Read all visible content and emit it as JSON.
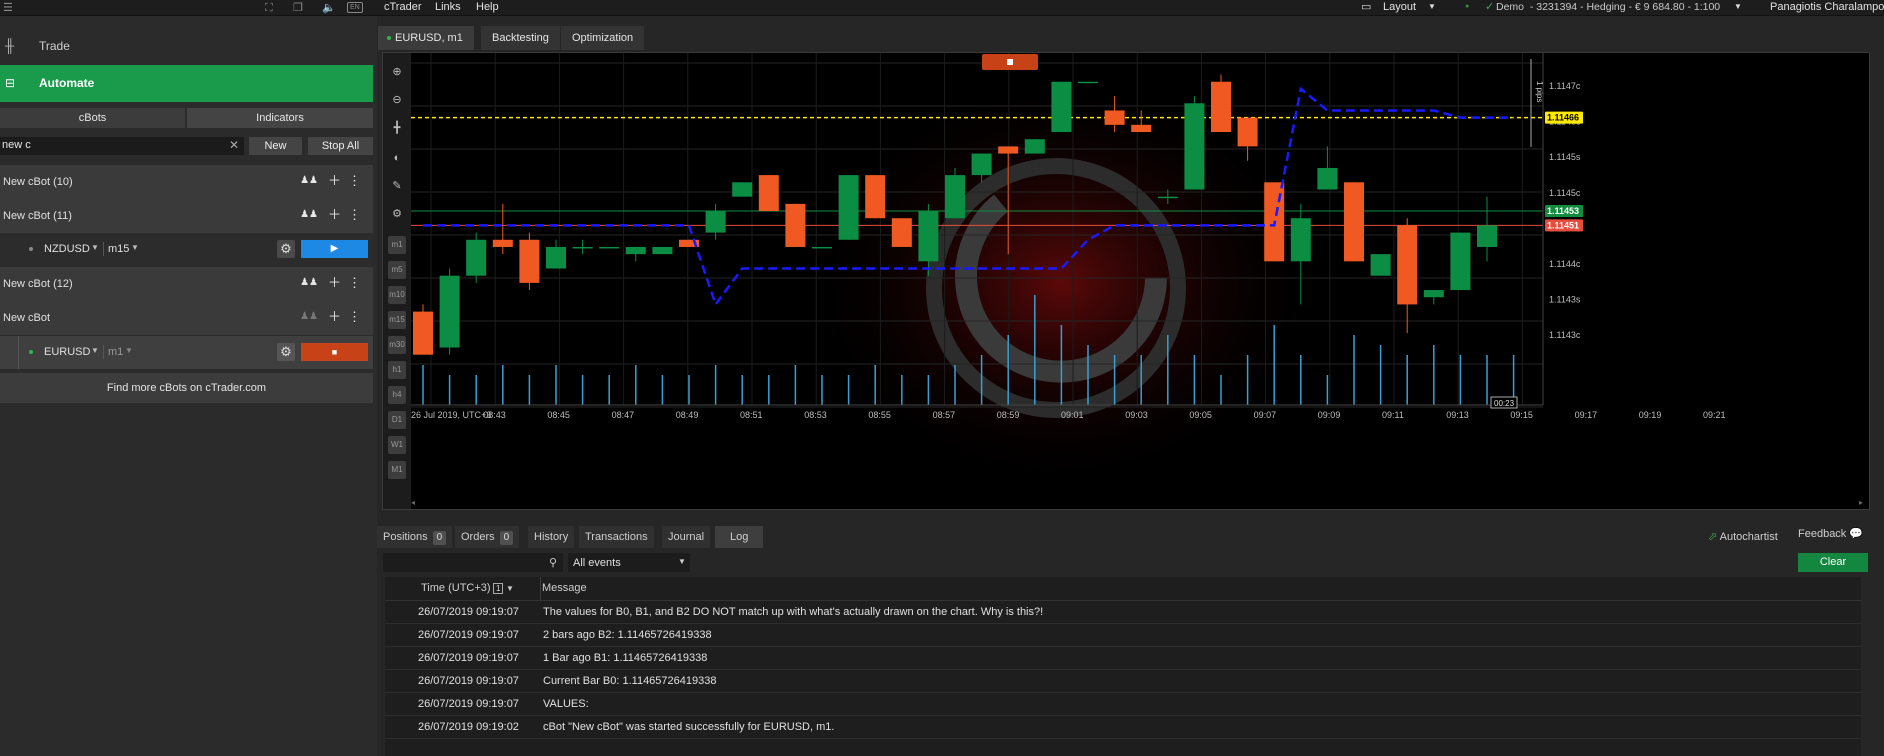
{
  "top_bar": {
    "icons": [
      "hamburger-menu-icon",
      "fullscreen-icon",
      "windows-icon",
      "sound-icon",
      "language-icon"
    ],
    "language": "EN",
    "menu": [
      "cTrader",
      "Links",
      "Help"
    ],
    "layout_label": "Layout",
    "account_info": "Demo  - 3231394 - Hedging - € 9 684.80 - 1:100",
    "user_name": "Panagiotis Charalampous"
  },
  "sidebar": {
    "trade_label": "Trade",
    "automate_label": "Automate",
    "tabs": [
      "cBots",
      "Indicators"
    ],
    "search_value": "new c",
    "new_button": "New",
    "stop_all_button": "Stop All",
    "bots": [
      {
        "name": "New cBot (10)"
      },
      {
        "name": "New cBot (11)",
        "instance": {
          "symbol": "NZDUSD",
          "timeframe": "m15",
          "state": "stopped"
        }
      },
      {
        "name": "New cBot (12)"
      },
      {
        "name": "New cBot",
        "instance": {
          "symbol": "EURUSD",
          "timeframe": "m1",
          "state": "running"
        }
      }
    ],
    "find_more": "Find more cBots on cTrader.com",
    "colors": {
      "automate": "#1a9b4b",
      "play": "#1e88e5",
      "stop": "#d04a1c"
    }
  },
  "chart_tabs": [
    "EURUSD, m1",
    "Backtesting",
    "Optimization"
  ],
  "chart_tools": [
    "zoom-in-icon",
    "zoom-out-icon",
    "crosshair-icon",
    "chart-type-icon",
    "drawing-icon",
    "template-icon"
  ],
  "timeframe_buttons": [
    "m1",
    "m5",
    "m10",
    "m15",
    "m30",
    "h1",
    "h4",
    "D1",
    "W1",
    "M1"
  ],
  "chart_data": {
    "type": "candlestick",
    "symbol": "EURUSD",
    "timeframe": "m1",
    "x_labels": [
      "26 Jul 2019, UTC+3",
      "08:43",
      "08:45",
      "08:47",
      "08:49",
      "08:51",
      "08:53",
      "08:55",
      "08:57",
      "08:59",
      "09:01",
      "09:03",
      "09:05",
      "09:07",
      "09:09",
      "09:11",
      "09:13",
      "09:15",
      "09:17",
      "09:19",
      "09:21"
    ],
    "y_labels": [
      "1.1147c",
      "1.1146c",
      "1.1145s",
      "1.1145c",
      "1.1144s",
      "1.1144c",
      "1.1143s",
      "1.1143c"
    ],
    "ylim": [
      1.11426,
      1.11475
    ],
    "candles": [
      {
        "o": 1.11439,
        "h": 1.1144,
        "l": 1.11435,
        "c": 1.11433
      },
      {
        "o": 1.11434,
        "h": 1.11445,
        "l": 1.11433,
        "c": 1.11444
      },
      {
        "o": 1.11444,
        "h": 1.1145,
        "l": 1.11443,
        "c": 1.11449
      },
      {
        "o": 1.11449,
        "h": 1.11454,
        "l": 1.11447,
        "c": 1.11448
      },
      {
        "o": 1.11449,
        "h": 1.1145,
        "l": 1.11442,
        "c": 1.11443
      },
      {
        "o": 1.11445,
        "h": 1.11449,
        "l": 1.11445,
        "c": 1.11448
      },
      {
        "o": 1.11448,
        "h": 1.11449,
        "l": 1.11447,
        "c": 1.11448
      },
      {
        "o": 1.11448,
        "h": 1.11448,
        "l": 1.11448,
        "c": 1.11448
      },
      {
        "o": 1.11447,
        "h": 1.11448,
        "l": 1.11446,
        "c": 1.11448
      },
      {
        "o": 1.11447,
        "h": 1.11448,
        "l": 1.11447,
        "c": 1.11448
      },
      {
        "o": 1.11449,
        "h": 1.11449,
        "l": 1.11448,
        "c": 1.11448
      },
      {
        "o": 1.1145,
        "h": 1.11454,
        "l": 1.11449,
        "c": 1.11453
      },
      {
        "o": 1.11455,
        "h": 1.11457,
        "l": 1.11455,
        "c": 1.11457
      },
      {
        "o": 1.11458,
        "h": 1.11458,
        "l": 1.11453,
        "c": 1.11453
      },
      {
        "o": 1.11454,
        "h": 1.11454,
        "l": 1.11448,
        "c": 1.11448
      },
      {
        "o": 1.11448,
        "h": 1.11448,
        "l": 1.11448,
        "c": 1.11448
      },
      {
        "o": 1.11449,
        "h": 1.11458,
        "l": 1.11449,
        "c": 1.11458
      },
      {
        "o": 1.11458,
        "h": 1.11458,
        "l": 1.11452,
        "c": 1.11452
      },
      {
        "o": 1.11452,
        "h": 1.11452,
        "l": 1.11448,
        "c": 1.11448
      },
      {
        "o": 1.11446,
        "h": 1.11454,
        "l": 1.11444,
        "c": 1.11453
      },
      {
        "o": 1.11452,
        "h": 1.11459,
        "l": 1.11452,
        "c": 1.11458
      },
      {
        "o": 1.11458,
        "h": 1.11461,
        "l": 1.11457,
        "c": 1.11461
      },
      {
        "o": 1.11462,
        "h": 1.11462,
        "l": 1.11447,
        "c": 1.11461
      },
      {
        "o": 1.11461,
        "h": 1.11463,
        "l": 1.11461,
        "c": 1.11463
      },
      {
        "o": 1.11464,
        "h": 1.11471,
        "l": 1.11464,
        "c": 1.11471
      },
      {
        "o": 1.11471,
        "h": 1.11471,
        "l": 1.11471,
        "c": 1.11471
      },
      {
        "o": 1.11467,
        "h": 1.11469,
        "l": 1.11464,
        "c": 1.11465
      },
      {
        "o": 1.11465,
        "h": 1.11467,
        "l": 1.11464,
        "c": 1.11464
      },
      {
        "o": 1.11455,
        "h": 1.11456,
        "l": 1.11454,
        "c": 1.11455
      },
      {
        "o": 1.11456,
        "h": 1.11469,
        "l": 1.11456,
        "c": 1.11468
      },
      {
        "o": 1.11471,
        "h": 1.11472,
        "l": 1.11464,
        "c": 1.11464
      },
      {
        "o": 1.11466,
        "h": 1.11466,
        "l": 1.1146,
        "c": 1.11462
      },
      {
        "o": 1.11457,
        "h": 1.11457,
        "l": 1.11446,
        "c": 1.11446
      },
      {
        "o": 1.11446,
        "h": 1.11454,
        "l": 1.1144,
        "c": 1.11452
      },
      {
        "o": 1.11456,
        "h": 1.11462,
        "l": 1.11456,
        "c": 1.11459
      },
      {
        "o": 1.11457,
        "h": 1.11457,
        "l": 1.11446,
        "c": 1.11446
      },
      {
        "o": 1.11444,
        "h": 1.11447,
        "l": 1.11444,
        "c": 1.11447
      },
      {
        "o": 1.11451,
        "h": 1.11452,
        "l": 1.11436,
        "c": 1.1144
      },
      {
        "o": 1.11441,
        "h": 1.11442,
        "l": 1.1144,
        "c": 1.11442
      },
      {
        "o": 1.11442,
        "h": 1.1145,
        "l": 1.11442,
        "c": 1.1145
      },
      {
        "o": 1.11448,
        "h": 1.11455,
        "l": 1.11446,
        "c": 1.11451
      }
    ],
    "indicator_line": [
      1.11451,
      1.11451,
      1.11451,
      1.11451,
      1.11451,
      1.11451,
      1.11451,
      1.11451,
      1.11451,
      1.11451,
      1.11451,
      1.1144,
      1.11445,
      1.11445,
      1.11445,
      1.11445,
      1.11445,
      1.11445,
      1.11445,
      1.11445,
      1.11445,
      1.11445,
      1.11445,
      1.11445,
      1.11445,
      1.11449,
      1.11451,
      1.11451,
      1.11451,
      1.11451,
      1.11451,
      1.11451,
      1.11451,
      1.1147,
      1.11467,
      1.11467,
      1.11467,
      1.11467,
      1.11467,
      1.11466,
      1.11466,
      1.11466
    ],
    "volumes": [
      4,
      3,
      3,
      4,
      3,
      4,
      3,
      3,
      4,
      3,
      3,
      4,
      3,
      3,
      4,
      3,
      3,
      4,
      3,
      3,
      4,
      5,
      7,
      11,
      8,
      6,
      5,
      5,
      7,
      5,
      3,
      5,
      8,
      5,
      3,
      7,
      6,
      5,
      6,
      5,
      5,
      5
    ],
    "levels": {
      "yellow": "1.11466",
      "green": "1.11453",
      "red": "1.11451"
    },
    "pips_label": "1 pips",
    "countdown": "00:23",
    "colors": {
      "bull": "#0c8d44",
      "bear": "#f05a22",
      "indicator": "#1a1aff",
      "volume": "#3a9fd6",
      "yellow": "#ffeb00",
      "green": "#138c3f",
      "red": "#e74c3c"
    }
  },
  "bottom_tabs": [
    {
      "label": "Positions",
      "count": "0"
    },
    {
      "label": "Orders",
      "count": "0"
    },
    {
      "label": "History"
    },
    {
      "label": "Transactions"
    },
    {
      "label": "Journal"
    },
    {
      "label": "Log"
    }
  ],
  "autochartist_label": "Autochartist",
  "feedback_label": "Feedback",
  "filter": {
    "select_value": "All events"
  },
  "clear_button": "Clear",
  "log": {
    "headers": [
      "Time (UTC+3)",
      "Message"
    ],
    "sort_badge": "1",
    "rows": [
      {
        "time": "26/07/2019 09:19:07",
        "message": "The values for B0, B1, and B2 DO NOT match up with what's actually drawn on the chart. Why is this?!"
      },
      {
        "time": "26/07/2019 09:19:07",
        "message": "2 bars ago B2: 1.11465726419338"
      },
      {
        "time": "26/07/2019 09:19:07",
        "message": "1 Bar ago B1: 1.11465726419338"
      },
      {
        "time": "26/07/2019 09:19:07",
        "message": "Current Bar B0: 1.11465726419338"
      },
      {
        "time": "26/07/2019 09:19:07",
        "message": "VALUES:"
      },
      {
        "time": "26/07/2019 09:19:02",
        "message": "cBot \"New cBot\" was started successfully for EURUSD, m1."
      }
    ]
  }
}
